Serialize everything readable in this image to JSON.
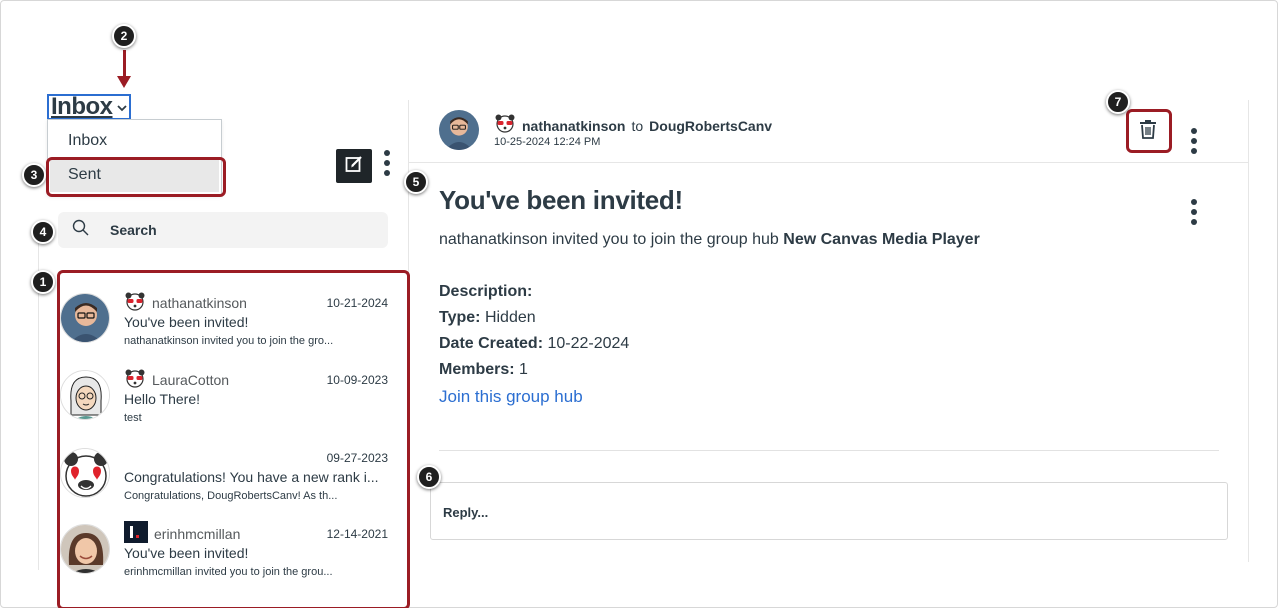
{
  "mailbox": {
    "selected": "Inbox",
    "options": [
      "Inbox",
      "Sent"
    ]
  },
  "search": {
    "label": "Search"
  },
  "conversations": [
    {
      "name": "nathanatkinson",
      "date": "10-21-2024",
      "subject": "You've been invited!",
      "preview": "nathanatkinson invited you to join the gro...",
      "icon": "panda-badge-icon"
    },
    {
      "name": "LauraCotton",
      "date": "10-09-2023",
      "subject": "Hello There!",
      "preview": "test",
      "icon": "panda-badge-icon"
    },
    {
      "name": "",
      "date": "09-27-2023",
      "subject": "Congratulations! You have a new rank i...",
      "preview": "Congratulations, DougRobertsCanv! As th..."
    },
    {
      "name": "erinhmcmillan",
      "date": "12-14-2021",
      "subject": "You've been invited!",
      "preview": "erinhmcmillan invited you to join the grou...",
      "icon": "instructure-logo-icon"
    }
  ],
  "message": {
    "from": "nathanatkinson",
    "to_word": "to",
    "recipient": "DougRobertsCanv",
    "date": "10-25-2024 12:24 PM",
    "title": "You've been invited!",
    "intro_text": "nathanatkinson invited you to join the group hub",
    "intro_hub": "New Canvas Media Player",
    "fields": [
      {
        "label": "Description:",
        "value": ""
      },
      {
        "label": "Type:",
        "value": "Hidden"
      },
      {
        "label": "Date Created:",
        "value": "10-22-2024"
      },
      {
        "label": "Members:",
        "value": "1"
      }
    ],
    "link": "Join this group hub",
    "reply_placeholder": "Reply..."
  },
  "callouts": [
    "1",
    "2",
    "3",
    "4",
    "5",
    "6",
    "7"
  ],
  "colors": {
    "highlight": "#9b1c24",
    "link": "#2b6ed1",
    "compose_bg": "#1f2529"
  }
}
